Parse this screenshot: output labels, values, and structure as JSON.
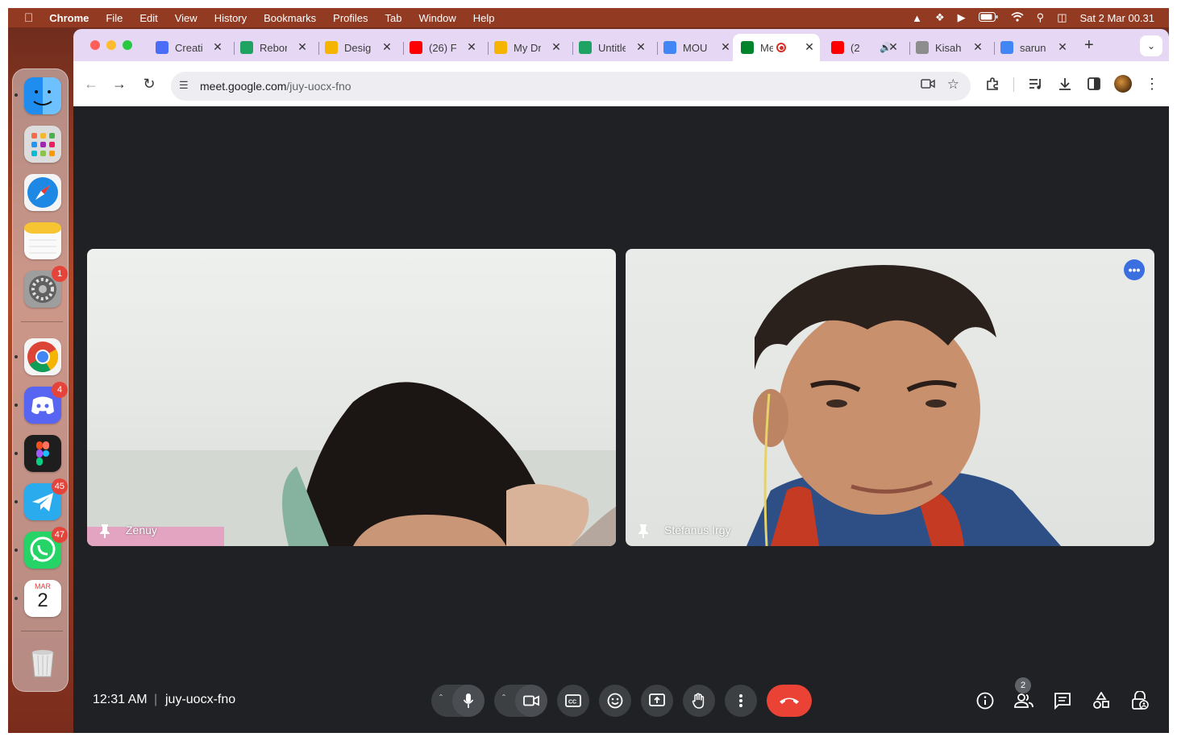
{
  "menubar": {
    "app_name": "Chrome",
    "items": [
      "File",
      "Edit",
      "View",
      "History",
      "Bookmarks",
      "Profiles",
      "Tab",
      "Window",
      "Help"
    ],
    "datetime": "Sat 2 Mar  00.31"
  },
  "dock": {
    "badges": {
      "settings": "1",
      "discord": "4",
      "telegram": "45",
      "whatsapp": "47"
    },
    "calendar": {
      "month": "MAR",
      "day": "2"
    }
  },
  "tabs": [
    {
      "title": "Creati",
      "icon": "canva-icon",
      "color": "#4a6cf7"
    },
    {
      "title": "Rebor",
      "icon": "sheets-icon",
      "color": "#1ea362"
    },
    {
      "title": "Desig",
      "icon": "drive-icon",
      "color": "#f4b400"
    },
    {
      "title": "(26) F",
      "icon": "youtube-icon",
      "color": "#ff0000"
    },
    {
      "title": "My Dr",
      "icon": "drive-icon",
      "color": "#f4b400"
    },
    {
      "title": "Untitle",
      "icon": "sheets-icon",
      "color": "#1ea362"
    },
    {
      "title": "MOU I",
      "icon": "docs-icon",
      "color": "#4285f4"
    },
    {
      "title": "Me",
      "icon": "meet-icon",
      "color": "#00832d",
      "active": true,
      "recording": true
    },
    {
      "title": "(2",
      "icon": "youtube-icon",
      "color": "#ff0000",
      "audio": true
    },
    {
      "title": "Kisah",
      "icon": "page-icon",
      "color": "#8d8d8d"
    },
    {
      "title": "sarun",
      "icon": "google-icon",
      "color": "#4285f4"
    }
  ],
  "address": {
    "host": "meet.google.com",
    "path": "/juy-uocx-fno"
  },
  "participants": [
    {
      "name": "Zenuy"
    },
    {
      "name": "Stefanus Irgy"
    }
  ],
  "meeting": {
    "time": "12:31 AM",
    "code": "juy-uocx-fno",
    "people_count": "2"
  },
  "colors": {
    "meet_bg": "#202124",
    "control_bg": "#3c4043",
    "end_call": "#ea4335",
    "tabstrip": "#e6d7f4"
  }
}
